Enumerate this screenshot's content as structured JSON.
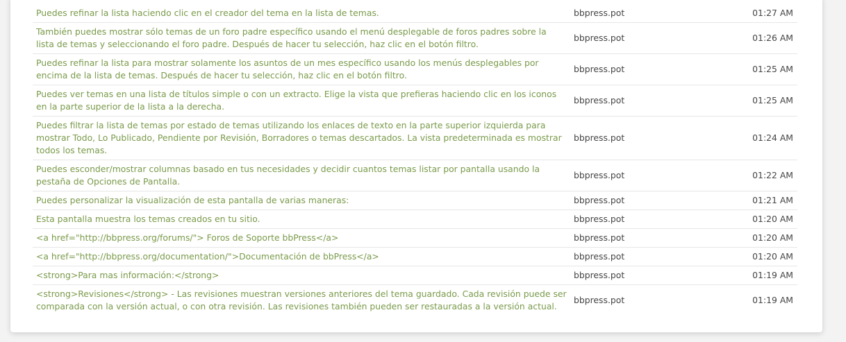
{
  "strings_table": {
    "rows": [
      {
        "text": "Puedes refinar la lista haciendo clic en el creador del tema en la lista de temas.",
        "file": "bbpress.pot",
        "time": "01:27 AM"
      },
      {
        "text": "También puedes mostrar sólo temas de un foro padre específico usando el menú desplegable de foros padres sobre la lista de temas y seleccionando el foro padre. Después de hacer tu selección, haz clic en el botón filtro.",
        "file": "bbpress.pot",
        "time": "01:26 AM"
      },
      {
        "text": "Puedes refinar la lista para mostrar solamente los asuntos de un mes específico usando los menús desplegables por encima de la lista de temas. Después de hacer tu selección, haz clic en el botón filtro.",
        "file": "bbpress.pot",
        "time": "01:25 AM"
      },
      {
        "text": "Puedes ver temas en una lista de títulos simple o con un extracto. Elige la vista que prefieras haciendo clic en los iconos en la parte superior de la lista a la derecha.",
        "file": "bbpress.pot",
        "time": "01:25 AM"
      },
      {
        "text": "Puedes filtrar la lista de temas por estado de temas utilizando los enlaces de texto en la parte superior izquierda para mostrar Todo, Lo Publicado, Pendiente por Revisión, Borradores o temas descartados. La vista predeterminada es mostrar todos los temas.",
        "file": "bbpress.pot",
        "time": "01:24 AM"
      },
      {
        "text": "Puedes esconder/mostrar columnas basado en tus necesidades y decidir cuantos temas listar por pantalla usando la pestaña de Opciones de Pantalla.",
        "file": "bbpress.pot",
        "time": "01:22 AM"
      },
      {
        "text": "Puedes personalizar la visualización de esta pantalla de varias maneras:",
        "file": "bbpress.pot",
        "time": "01:21 AM"
      },
      {
        "text": "Esta pantalla muestra los temas creados en tu sitio.",
        "file": "bbpress.pot",
        "time": "01:20 AM"
      },
      {
        "text": "<a href=\"http://bbpress.org/forums/\"> Foros de Soporte bbPress</a>",
        "file": "bbpress.pot",
        "time": "01:20 AM"
      },
      {
        "text": "<a href=\"http://bbpress.org/documentation/\">Documentación de bbPress</a>",
        "file": "bbpress.pot",
        "time": "01:20 AM"
      },
      {
        "text": "<strong>Para mas información:</strong>",
        "file": "bbpress.pot",
        "time": "01:19 AM"
      },
      {
        "text": "<strong>Revisiones</strong> - Las revisiones muestran versiones anteriores del tema guardado. Cada revisión puede ser comparada con la versión actual, o con otra revisión. Las revisiones también pueden ser restauradas a la versión actual.",
        "file": "bbpress.pot",
        "time": "01:19 AM"
      }
    ]
  },
  "colors": {
    "link_green": "#7a9a4a",
    "text_gray": "#444444",
    "divider": "#e6e6e6",
    "background": "#f3f3f3"
  }
}
